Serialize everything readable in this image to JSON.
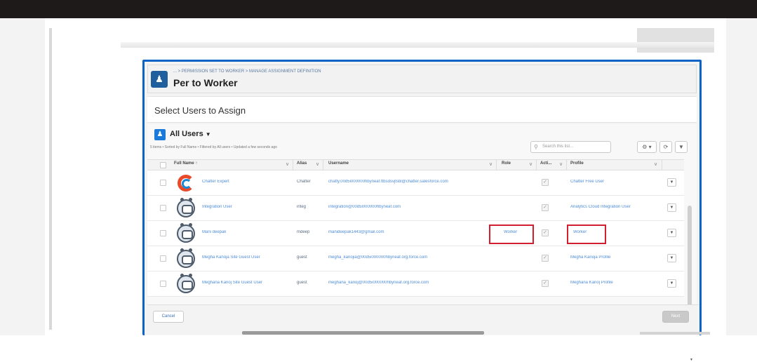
{
  "modal": {
    "breadcrumb": "... > PERMISSION SET TO WORKER > MANAGE ASSIGNMENT DEFINITION",
    "title": "Per to Worker",
    "subheading": "Select Users to Assign"
  },
  "list_view": {
    "title": "All Users",
    "meta": "5 items • Sorted by Full Name • Filtered by All users • Updated a few seconds ago",
    "search_placeholder": "Search this list...",
    "settings_glyph": "⚙ ▾",
    "refresh_glyph": "⟳",
    "filter_glyph": "▼"
  },
  "columns": {
    "full_name": "Full Name ↑",
    "alias": "Alias",
    "username": "Username",
    "role": "Role",
    "active": "Acti...",
    "profile": "Profile"
  },
  "rows": [
    {
      "full_name": "Chatter Expert",
      "alias": "Chatter",
      "username": "chatty.00d5i000000hbyneaf.ttbsdsvjtsbl@chatter.salesforce.com",
      "role": "",
      "active": "✓",
      "profile": "Chatter Free User",
      "avatar": "logo-icon"
    },
    {
      "full_name": "Integration User",
      "alias": "integ",
      "username": "integration@00d5i000000hbyneaf.com",
      "role": "",
      "active": "✓",
      "profile": "Analytics Cloud Integration User",
      "avatar": "astro-icon"
    },
    {
      "full_name": "Mani deepak",
      "alias": "mdeep",
      "username": "manideepak1443@gmail.com",
      "role": "Worker",
      "active": "✓",
      "profile": "Worker",
      "avatar": "astro-icon"
    },
    {
      "full_name": "Megha Kanoja Site Guest User",
      "alias": "guest",
      "username": "megha_kanojia@00d5i000000hbyneaf.org.force.com",
      "role": "",
      "active": "✓",
      "profile": "Megha Kanoja Profile",
      "avatar": "astro-icon"
    },
    {
      "full_name": "Meghana Kanoj Site Guest User",
      "alias": "guest",
      "username": "meghana_kanoj@00d5i000000hbyneaf.org.force.com",
      "role": "",
      "active": "✓",
      "profile": "Meghana Kanoj Profile",
      "avatar": "astro-icon"
    }
  ],
  "footer": {
    "cancel_label": "Cancel",
    "next_label": "Next"
  },
  "colors": {
    "modal_border": "#0b63c6",
    "header_icon": "#1f5f9e",
    "link": "#4f8dd6",
    "highlight": "#d21f2f"
  }
}
